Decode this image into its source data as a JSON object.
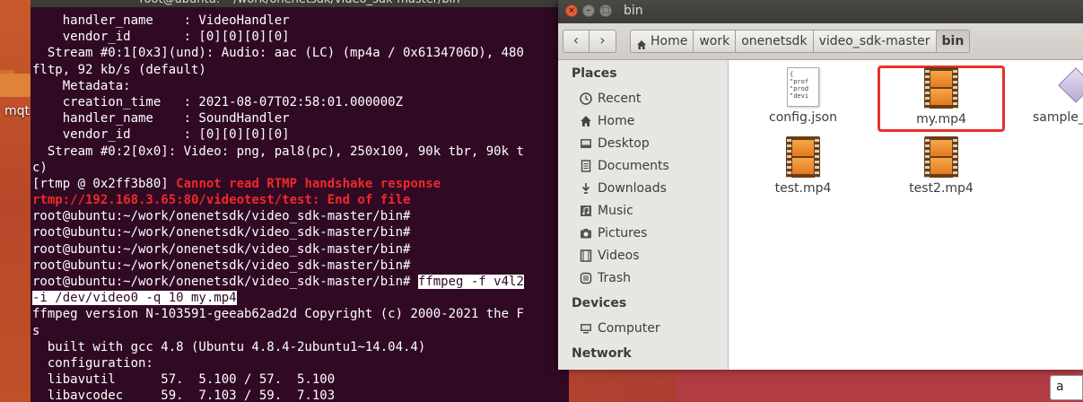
{
  "desktop": {
    "folder_label": "mqt"
  },
  "terminal": {
    "title": "root@ubuntu: ~/work/onenetsdk/video_sdk-master/bin",
    "lines": [
      {
        "text": "    handler_name    : VideoHandler",
        "style": "normal"
      },
      {
        "text": "    vendor_id       : [0][0][0][0]",
        "style": "normal"
      },
      {
        "text": "  Stream #0:1[0x3](und): Audio: aac (LC) (mp4a / 0x6134706D), 480",
        "style": "normal"
      },
      {
        "text": "fltp, 92 kb/s (default)",
        "style": "normal"
      },
      {
        "text": "    Metadata:",
        "style": "normal"
      },
      {
        "text": "    creation_time   : 2021-08-07T02:58:01.000000Z",
        "style": "normal"
      },
      {
        "text": "    handler_name    : SoundHandler",
        "style": "normal"
      },
      {
        "text": "    vendor_id       : [0][0][0][0]",
        "style": "normal"
      },
      {
        "text": "  Stream #0:2[0x0]: Video: png, pal8(pc), 250x100, 90k tbr, 90k t",
        "style": "normal"
      },
      {
        "text": "c)",
        "style": "normal"
      },
      {
        "text": "[rtmp @ 0x2ff3b80] ",
        "style": "normal",
        "err": "Cannot read RTMP handshake response"
      },
      {
        "text": "",
        "style": "normal",
        "err": "rtmp://192.168.3.65:80/videotest/test: End of file"
      },
      {
        "text": "root@ubuntu:~/work/onenetsdk/video_sdk-master/bin#",
        "style": "normal"
      },
      {
        "text": "root@ubuntu:~/work/onenetsdk/video_sdk-master/bin#",
        "style": "normal"
      },
      {
        "text": "root@ubuntu:~/work/onenetsdk/video_sdk-master/bin#",
        "style": "normal"
      },
      {
        "text": "root@ubuntu:~/work/onenetsdk/video_sdk-master/bin#",
        "style": "normal"
      },
      {
        "text": "root@ubuntu:~/work/onenetsdk/video_sdk-master/bin# ",
        "style": "normal",
        "sel": "ffmpeg -f v4l2"
      },
      {
        "text": "",
        "style": "normal",
        "sel": "-i /dev/video0 -q 10 my.mp4"
      },
      {
        "text": "ffmpeg version N-103591-geeab62ad2d Copyright (c) 2000-2021 the F",
        "style": "normal"
      },
      {
        "text": "s",
        "style": "normal"
      },
      {
        "text": "  built with gcc 4.8 (Ubuntu 4.8.4-2ubuntu1~14.04.4)",
        "style": "normal"
      },
      {
        "text": "  configuration:",
        "style": "normal"
      },
      {
        "text": "  libavutil      57.  5.100 / 57.  5.100",
        "style": "normal"
      },
      {
        "text": "  libavcodec     59.  7.103 / 59.  7.103",
        "style": "normal"
      }
    ]
  },
  "nautilus": {
    "title": "bin",
    "breadcrumbs": [
      "Home",
      "work",
      "onenetsdk",
      "video_sdk-master",
      "bin"
    ],
    "sidebar": {
      "places_header": "Places",
      "places": [
        {
          "label": "Recent",
          "icon": "clock-icon"
        },
        {
          "label": "Home",
          "icon": "home-icon"
        },
        {
          "label": "Desktop",
          "icon": "desktop-icon"
        },
        {
          "label": "Documents",
          "icon": "documents-icon"
        },
        {
          "label": "Downloads",
          "icon": "download-icon"
        },
        {
          "label": "Music",
          "icon": "music-icon"
        },
        {
          "label": "Pictures",
          "icon": "camera-icon"
        },
        {
          "label": "Videos",
          "icon": "video-icon"
        },
        {
          "label": "Trash",
          "icon": "trash-icon"
        }
      ],
      "devices_header": "Devices",
      "devices": [
        {
          "label": "Computer",
          "icon": "computer-icon"
        }
      ],
      "network_header": "Network"
    },
    "files": [
      {
        "name": "config.json",
        "type": "text",
        "preview": "{\n\"prof\n\"prod\n\"devi"
      },
      {
        "name": "my.mp4",
        "type": "video",
        "highlighted": true
      },
      {
        "name": "sample_",
        "type": "other"
      },
      {
        "name": "test.mp4",
        "type": "video"
      },
      {
        "name": "test2.mp4",
        "type": "video"
      }
    ],
    "highlight_color": "#e8302a"
  },
  "search": {
    "value": "a"
  }
}
